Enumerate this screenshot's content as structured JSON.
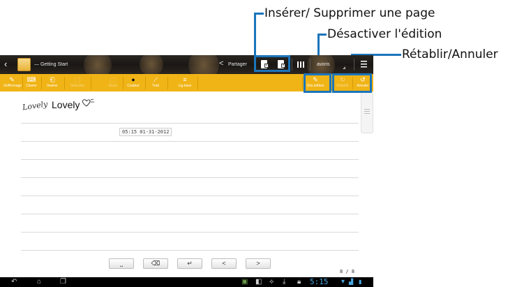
{
  "callouts": {
    "insert_delete_page": "Insérer/ Supprimer une page",
    "disable_edit": "Désactiver l'édition",
    "redo_undo": "Rétablir/Annuler"
  },
  "actionbar": {
    "notebook_title": "— Getting Start",
    "share_label": "Partager",
    "favorites_label": "avoris"
  },
  "toolbar": {
    "items": [
      "Griffonnage",
      "Clavier",
      "Insérer",
      "Sélection",
      "Zoom",
      "Couleur",
      "Trait",
      "Lig.base"
    ],
    "disable_edit_label": "Dés.édition",
    "redo_label": "Rétablir",
    "undo_label": "Annuler",
    "accent_color": "#f0b416"
  },
  "page": {
    "handwriting": "Lovely",
    "typed_text": "Lovely",
    "timestamp": "05:15 01-31-2012",
    "page_counter": "8 / 8"
  },
  "keyboard": {
    "space": "⎵",
    "backspace": "⌫",
    "enter": "↵",
    "prev": "<",
    "next": ">"
  },
  "statusbar": {
    "clock": "5:15"
  }
}
